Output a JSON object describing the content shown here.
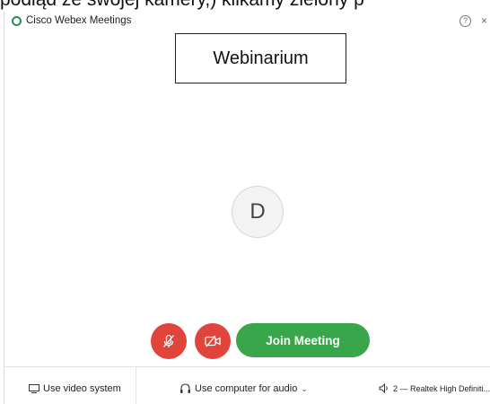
{
  "document": {
    "caption": "podiąd ze swojej kamery,) klikamy zielony p"
  },
  "window": {
    "title": "Cisco Webex Meetings",
    "help_symbol": "?",
    "close_symbol": "×"
  },
  "overlay": {
    "label": "Webinarium"
  },
  "participant": {
    "avatar_initial": "D"
  },
  "controls": {
    "join_label": "Join Meeting"
  },
  "bottom_bar": {
    "video_system_label": "Use video system",
    "audio_label": "Use computer for audio",
    "speaker_label": "2 — Realtek High Definiti..."
  },
  "colors": {
    "accent_green": "#3aa64b",
    "danger_red": "#e0443b",
    "logo_green": "#2e8b57"
  },
  "icons": {
    "logo": "webex-logo-icon",
    "help": "help-icon",
    "close": "close-icon",
    "mic_muted": "mic-muted-icon",
    "video_off": "video-off-icon",
    "video_system": "video-system-icon",
    "headset": "headset-icon",
    "speaker": "speaker-icon"
  }
}
